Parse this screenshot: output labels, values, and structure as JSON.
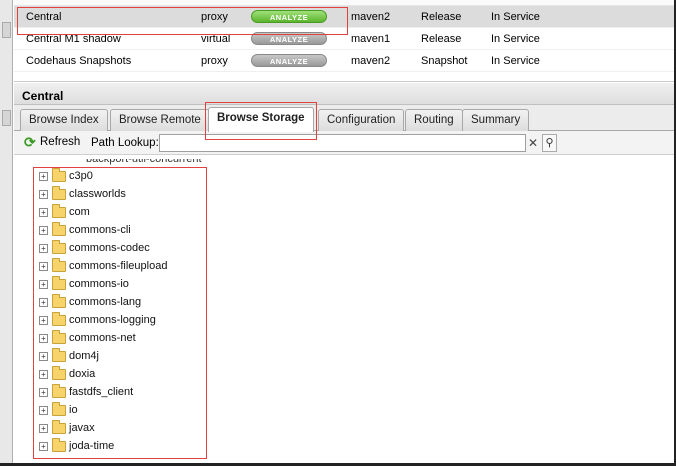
{
  "repositories": [
    {
      "name": "Central",
      "type": "proxy",
      "analyze": "ANALYZE",
      "analyze_state": "active",
      "format": "maven2",
      "policy": "Release",
      "status": "In Service"
    },
    {
      "name": "Central M1 shadow",
      "type": "virtual",
      "analyze": "ANALYZE",
      "analyze_state": "disabled",
      "format": "maven1",
      "policy": "Release",
      "status": "In Service"
    },
    {
      "name": "Codehaus Snapshots",
      "type": "proxy",
      "analyze": "ANALYZE",
      "analyze_state": "disabled",
      "format": "maven2",
      "policy": "Snapshot",
      "status": "In Service"
    }
  ],
  "panel": {
    "title": "Central",
    "tabs": [
      {
        "label": "Browse Index",
        "active": false
      },
      {
        "label": "Browse Remote",
        "active": false
      },
      {
        "label": "Browse Storage",
        "active": true
      },
      {
        "label": "Configuration",
        "active": false
      },
      {
        "label": "Routing",
        "active": false
      },
      {
        "label": "Summary",
        "active": false
      }
    ],
    "toolbar": {
      "refresh_label": "Refresh",
      "path_lookup_label": "Path Lookup:",
      "path_lookup_value": "",
      "clear_glyph": "✕",
      "search_glyph": "⚲"
    },
    "tree": {
      "cut_off_item": "backport-util-concurrent",
      "items": [
        "c3p0",
        "classworlds",
        "com",
        "commons-cli",
        "commons-codec",
        "commons-fileupload",
        "commons-io",
        "commons-lang",
        "commons-logging",
        "commons-net",
        "dom4j",
        "doxia",
        "fastdfs_client",
        "io",
        "javax",
        "joda-time"
      ],
      "expander_glyph": "+"
    }
  },
  "colors": {
    "highlight": "#e04040",
    "analyze_active": "#5cb52d",
    "analyze_disabled": "#999999",
    "selected_row": "#dcdcdc"
  },
  "icons": {
    "refresh": "refresh-icon",
    "folder": "folder-icon",
    "expand": "plus-expand-icon",
    "clear": "clear-icon",
    "search": "search-icon"
  }
}
